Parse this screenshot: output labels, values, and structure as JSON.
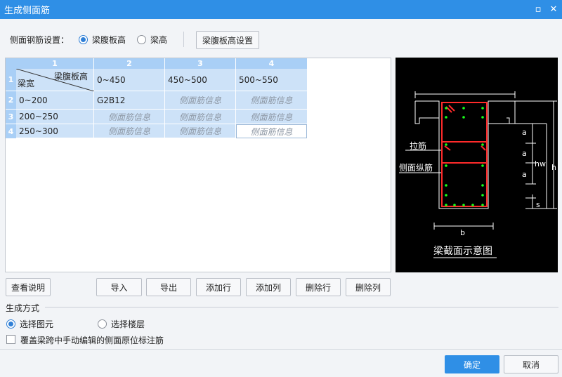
{
  "window": {
    "title": "生成侧面筋"
  },
  "setting": {
    "label": "侧面钢筋设置：",
    "options": [
      "梁腹板高",
      "梁高"
    ],
    "selected": 0,
    "config_button": "梁腹板高设置"
  },
  "table": {
    "col_headers": [
      "1",
      "2",
      "3",
      "4"
    ],
    "row_headers": [
      "1",
      "2",
      "3",
      "4"
    ],
    "corner_top": "梁腹板高",
    "corner_bottom": "梁宽",
    "heights": [
      "0~450",
      "450~500",
      "500~550"
    ],
    "rows": [
      {
        "width": "0~200",
        "cells": [
          "G2B12",
          "侧面筋信息",
          "侧面筋信息"
        ]
      },
      {
        "width": "200~250",
        "cells": [
          "侧面筋信息",
          "侧面筋信息",
          "侧面筋信息"
        ]
      },
      {
        "width": "250~300",
        "cells": [
          "侧面筋信息",
          "侧面筋信息",
          "侧面筋信息"
        ]
      }
    ]
  },
  "diagram": {
    "caption": "梁截面示意图",
    "label_tie": "拉筋",
    "label_side": "侧面纵筋",
    "dim_a": "a",
    "dim_hw": "hw",
    "dim_h": "h",
    "dim_s": "s",
    "dim_b": "b"
  },
  "buttons": {
    "view_help": "查看说明",
    "import": "导入",
    "export": "导出",
    "add_row": "添加行",
    "add_col": "添加列",
    "del_row": "删除行",
    "del_col": "删除列"
  },
  "generate": {
    "title": "生成方式",
    "options": [
      "选择图元",
      "选择楼层"
    ],
    "selected": 0,
    "overwrite_label": "覆盖梁跨中手动编辑的侧面原位标注筋",
    "overwrite_checked": false
  },
  "footer": {
    "ok": "确定",
    "cancel": "取消"
  }
}
